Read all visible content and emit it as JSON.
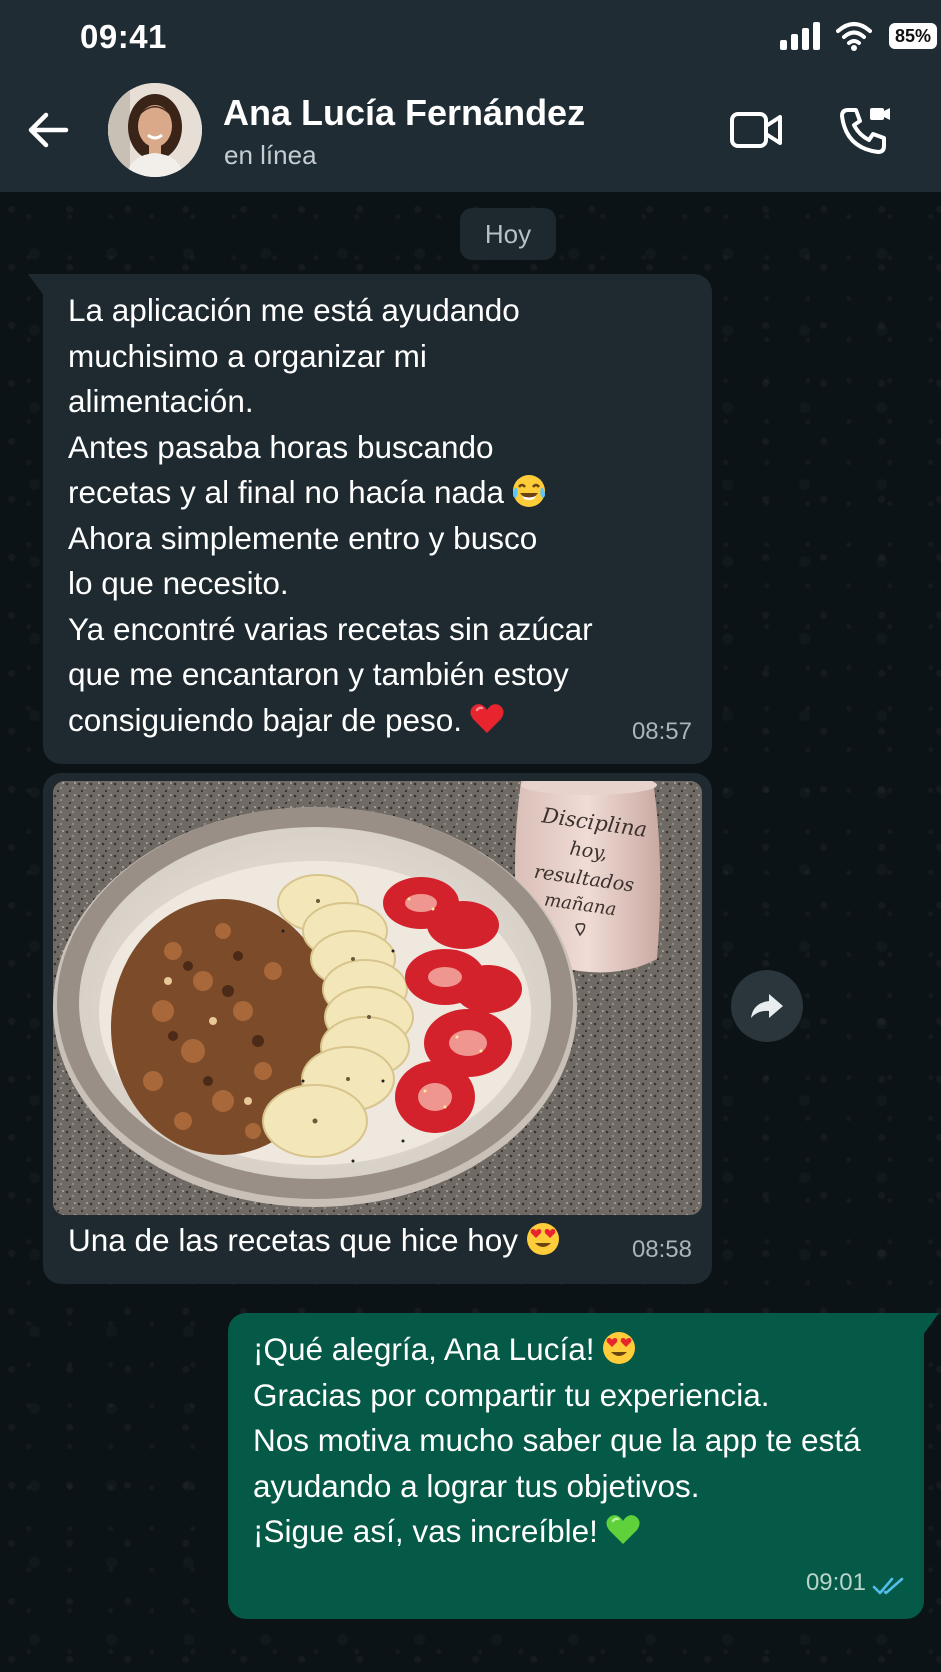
{
  "status_bar": {
    "time": "09:41",
    "battery": "85%"
  },
  "header": {
    "contact_name": "Ana Lucía Fernández",
    "contact_status": "en línea",
    "icons": [
      "back-arrow-icon",
      "video-call-icon",
      "voice-call-icon"
    ]
  },
  "chat": {
    "date_chip": "Hoy",
    "messages": [
      {
        "direction": "incoming",
        "lines": [
          "La aplicación me está ayudando",
          "muchisimo a organizar mi",
          "alimentación.",
          "Antes pasaba horas buscando",
          "recetas y al final no hacía nada",
          "Ahora simplemente entro y busco",
          "lo que necesito.",
          "Ya encontré varias recetas sin azúcar",
          "que me encantaron y también estoy",
          "consiguiendo bajar de peso."
        ],
        "emojis": [
          "tears-of-joy-emoji",
          "red-heart-emoji"
        ],
        "time": "08:57"
      },
      {
        "direction": "incoming",
        "type": "image",
        "image_mug_text": [
          "Disciplina",
          "hoy,",
          "resultados",
          "mañana"
        ],
        "caption": "Una de las recetas que hice hoy",
        "emojis": [
          "heart-eyes-emoji"
        ],
        "time": "08:58"
      },
      {
        "direction": "outgoing",
        "lines": [
          "¡Qué alegría, Ana Lucía!",
          "Gracias por compartir tu experiencia.",
          "Nos motiva mucho saber que la app te está",
          "ayudando a lograr tus objetivos.",
          "¡Sigue así, vas increíble!"
        ],
        "emojis": [
          "heart-eyes-emoji",
          "green-heart-emoji"
        ],
        "time": "09:01",
        "read_receipt": "double-check-blue"
      }
    ]
  },
  "colors": {
    "header_bg": "#1f2c33",
    "incoming_bubble": "#1f2a30",
    "outgoing_bubble": "#055947",
    "read_tick": "#53bdeb"
  }
}
